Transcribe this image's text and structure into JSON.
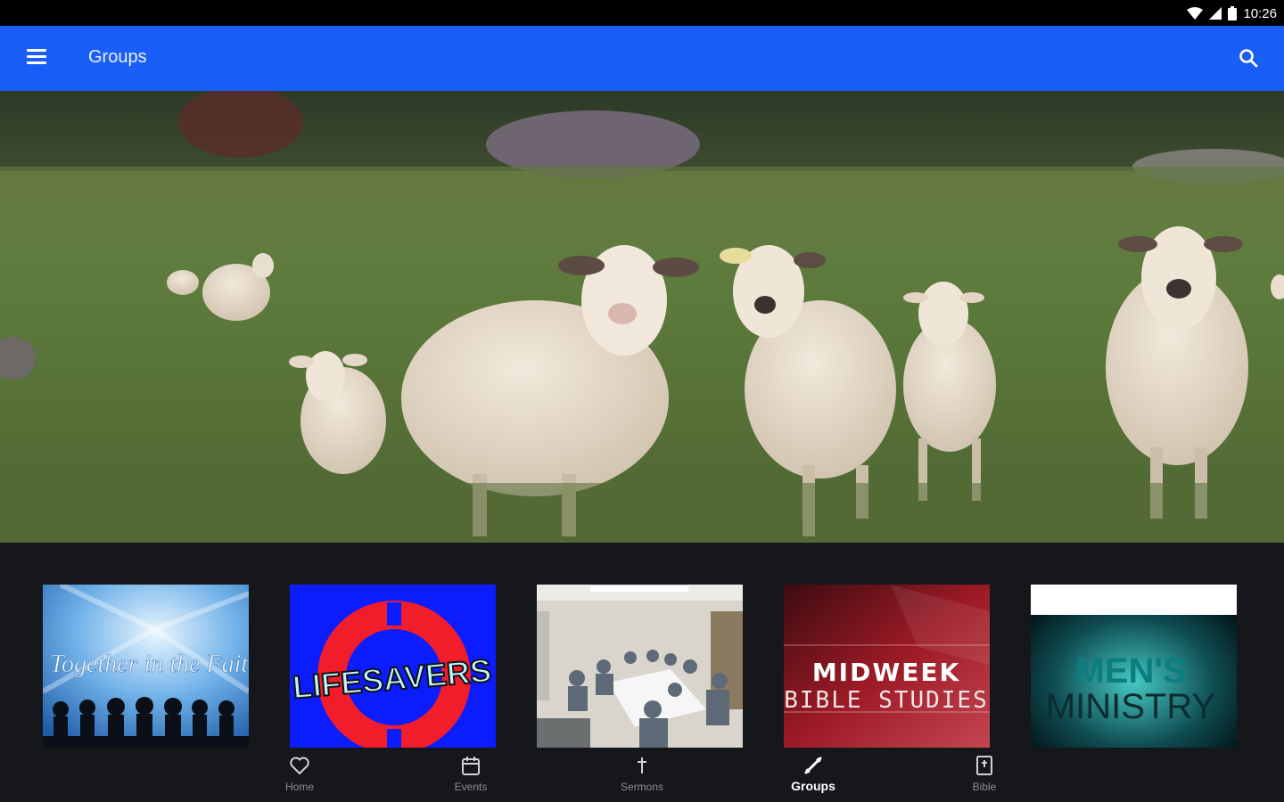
{
  "status_bar": {
    "time": "10:26",
    "icons": [
      "wifi-icon",
      "signal-icon",
      "battery-icon"
    ]
  },
  "app_bar": {
    "title": "Groups",
    "left_icon": "menu-icon",
    "right_icon": "search-icon",
    "color": "#1a5ef8"
  },
  "hero": {
    "image": "sheep-in-pasture"
  },
  "groups": [
    {
      "id": "together",
      "image_text": "Together in the Faith"
    },
    {
      "id": "lifesavers",
      "image_text": "LIFESAVERS"
    },
    {
      "id": "meeting",
      "image_text": ""
    },
    {
      "id": "midweek",
      "image_text_line1": "MIDWEEK",
      "image_text_line2": "BIBLE STUDIES"
    },
    {
      "id": "mens",
      "image_text_line1": "MEN'S",
      "image_text_line2": "MINISTRY"
    }
  ],
  "bottom_nav": {
    "items": [
      {
        "label": "Home",
        "icon": "heart-icon",
        "active": false
      },
      {
        "label": "Events",
        "icon": "calendar-icon",
        "active": false
      },
      {
        "label": "Sermons",
        "icon": "cross-icon",
        "active": false
      },
      {
        "label": "Groups",
        "icon": "handshake-icon",
        "active": true
      },
      {
        "label": "Bible",
        "icon": "bible-icon",
        "active": false
      }
    ]
  }
}
